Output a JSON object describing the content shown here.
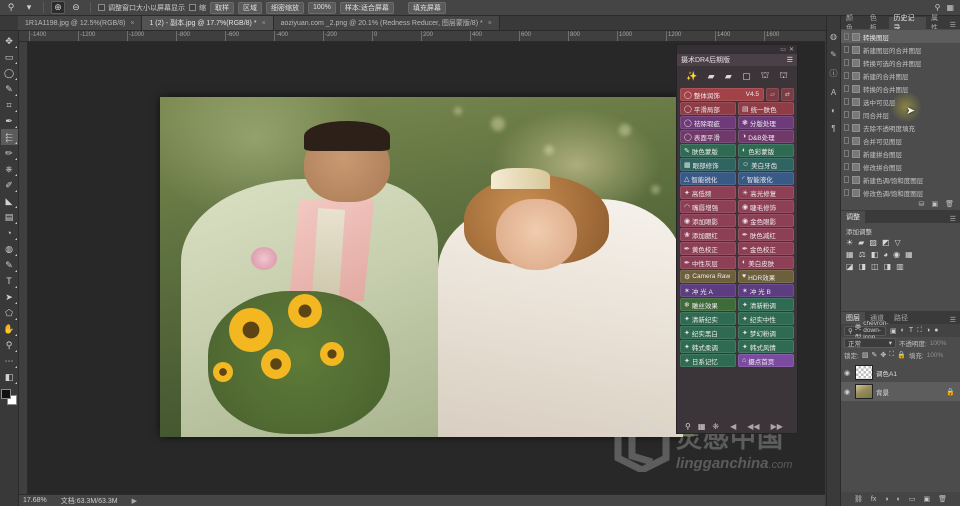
{
  "options_bar": {
    "tool_icon": "zoom-icon",
    "dropdown_icon": "chevron-down-icon",
    "zoom_in_icon": "zoom-in-icon",
    "zoom_out_icon": "zoom-out-icon",
    "checkbox1_label": "调整窗口大小以屏幕显示",
    "checkbox2_label": "缩",
    "buttons": [
      "取样",
      "区域",
      "细密缩放"
    ],
    "zoom_value": "100%",
    "fit_label": "样本:适合屏幕",
    "fill_label": "填充屏幕"
  },
  "tabs": [
    {
      "label": "1R1A1198.jpg @ 12.5%(RGB/8)",
      "close": "×",
      "active": false
    },
    {
      "label": "1 (2) - 副本.jpg @ 17.7%(RGB/8) *",
      "close": "×",
      "active": true
    },
    {
      "label": "aoziyuan.com _2.png @ 20.1% (Redness Reducer, 图层蒙版/8) *",
      "close": "×",
      "active": false
    }
  ],
  "toolbar": {
    "tools": [
      {
        "name": "move-tool",
        "glyph": "✥"
      },
      {
        "name": "marquee-tool",
        "glyph": "▭"
      },
      {
        "name": "lasso-tool",
        "glyph": "◯"
      },
      {
        "name": "quick-select-tool",
        "glyph": "✎"
      },
      {
        "name": "crop-tool",
        "glyph": "⌗"
      },
      {
        "name": "eyedropper-tool",
        "glyph": "✒"
      },
      {
        "name": "healing-brush-tool",
        "glyph": "⬱"
      },
      {
        "name": "brush-tool",
        "glyph": "✏"
      },
      {
        "name": "clone-stamp-tool",
        "glyph": "⎈"
      },
      {
        "name": "history-brush-tool",
        "glyph": "✐"
      },
      {
        "name": "eraser-tool",
        "glyph": "◣"
      },
      {
        "name": "gradient-tool",
        "glyph": "▤"
      },
      {
        "name": "blur-tool",
        "glyph": "◔"
      },
      {
        "name": "dodge-tool",
        "glyph": "◍"
      },
      {
        "name": "pen-tool",
        "glyph": "✎"
      },
      {
        "name": "type-tool",
        "glyph": "T"
      },
      {
        "name": "path-select-tool",
        "glyph": "➤"
      },
      {
        "name": "shape-tool",
        "glyph": "⬠"
      },
      {
        "name": "hand-tool",
        "glyph": "✋"
      },
      {
        "name": "zoom-tool",
        "glyph": "⚲"
      },
      {
        "name": "more-tools",
        "glyph": "⋯"
      },
      {
        "name": "quickmask-tool",
        "glyph": "◧"
      }
    ],
    "active_tool_index": 6,
    "foreground_color": "#111111",
    "background_color": "#ffffff"
  },
  "ruler": {
    "ticks": [
      "-1400",
      "-1200",
      "-1000",
      "-800",
      "-600",
      "-400",
      "-200",
      "0",
      "200",
      "400",
      "600",
      "800",
      "1000",
      "1200",
      "1400",
      "1600"
    ]
  },
  "dr_panel": {
    "title": "摄术DR4后期版",
    "menu_icon": "panel-menu-icon",
    "minimize_icon": "minimize-icon",
    "close_icon": "close-icon",
    "toolicons": [
      "magic-wand-icon",
      "eraser-icon",
      "eraser-alt-icon",
      "rectangle-icon",
      "stamp-icon",
      "stamp-plus-icon"
    ],
    "rows": [
      {
        "buttons": [
          {
            "label": "整体润饰",
            "version": "V4.5",
            "icon": "lasso-icon",
            "color": "#a04248",
            "wide": true
          },
          {
            "label": "",
            "icon": "shape-icon",
            "color": "#7c3a42",
            "mini": true
          },
          {
            "label": "",
            "icon": "sliders-icon",
            "color": "#7c3a42",
            "mini": true
          }
        ]
      },
      {
        "buttons": [
          {
            "label": "平滑局部",
            "icon": "lasso-icon",
            "color": "#8e3d47"
          },
          {
            "label": "统一肤色",
            "icon": "layers-icon",
            "color": "#8e3d47"
          }
        ]
      },
      {
        "buttons": [
          {
            "label": "祛除瑕疵",
            "icon": "lasso-icon",
            "color": "#6d3b7a"
          },
          {
            "label": "分版处理",
            "icon": "stack-icon",
            "color": "#6d3b7a"
          }
        ]
      },
      {
        "buttons": [
          {
            "label": "表面平滑",
            "icon": "lasso-icon",
            "color": "#6f3a6a"
          },
          {
            "label": "D&B处理",
            "icon": "circle-icon",
            "color": "#6f3a6a"
          }
        ]
      },
      {
        "buttons": [
          {
            "label": "肤色蒙版",
            "icon": "brush-icon",
            "color": "#2f6b52"
          },
          {
            "label": "色彩蒙版",
            "icon": "mask-icon",
            "color": "#2f6b52"
          }
        ]
      },
      {
        "buttons": [
          {
            "label": "眼部修饰",
            "icon": "film-icon",
            "color": "#2f6460"
          },
          {
            "label": "美白牙齿",
            "icon": "teeth-icon",
            "color": "#2f6460"
          }
        ]
      },
      {
        "buttons": [
          {
            "label": "智能锐化",
            "icon": "triangle-icon",
            "color": "#3a5a86"
          },
          {
            "label": "智能液化",
            "icon": "liquify-icon",
            "color": "#3a5a86"
          }
        ]
      },
      {
        "buttons": [
          {
            "label": "高低频",
            "icon": "wand-icon",
            "color": "#8c3f55"
          },
          {
            "label": "高光修复",
            "icon": "sun-icon",
            "color": "#8c3f55"
          }
        ]
      },
      {
        "buttons": [
          {
            "label": "嘴唇增强",
            "icon": "lips-icon",
            "color": "#8c3f55"
          },
          {
            "label": "睫毛修饰",
            "icon": "eye-icon",
            "color": "#8c3f55"
          }
        ]
      },
      {
        "buttons": [
          {
            "label": "添加眼影",
            "icon": "eye-icon",
            "color": "#8c3f55"
          },
          {
            "label": "金色眼影",
            "icon": "eye-icon",
            "color": "#8c3f55"
          }
        ]
      },
      {
        "buttons": [
          {
            "label": "添加腮红",
            "icon": "blush-icon",
            "color": "#8c3f55"
          },
          {
            "label": "肤色减红",
            "icon": "pen-icon",
            "color": "#8c3f55"
          }
        ]
      },
      {
        "buttons": [
          {
            "label": "黄色校正",
            "icon": "pen-icon",
            "color": "#8c3f55"
          },
          {
            "label": "金色校正",
            "icon": "pen-icon",
            "color": "#8c3f55"
          }
        ]
      },
      {
        "buttons": [
          {
            "label": "中性灰层",
            "icon": "pen-icon",
            "color": "#8c3f55"
          },
          {
            "label": "美白皮肤",
            "icon": "mask-icon",
            "color": "#8c3f55"
          }
        ]
      },
      {
        "buttons": [
          {
            "label": "Camera Raw",
            "icon": "gear-icon",
            "color": "#6b5f3c"
          },
          {
            "label": "HDR效果",
            "icon": "heart-icon",
            "color": "#6b5f3c"
          }
        ]
      },
      {
        "buttons": [
          {
            "label": "冲 光 A",
            "icon": "star-icon",
            "color": "#5b3d80"
          },
          {
            "label": "冲 光 B",
            "icon": "star-icon",
            "color": "#5b3d80"
          }
        ]
      },
      {
        "buttons": [
          {
            "label": "雕丝效果",
            "icon": "snowflake-icon",
            "color": "#3f6b3a"
          },
          {
            "label": "清新粉调",
            "icon": "wand-icon",
            "color": "#2f6b52"
          }
        ]
      },
      {
        "buttons": [
          {
            "label": "清新纪实",
            "icon": "wand-icon",
            "color": "#2f6b52"
          },
          {
            "label": "纪实中性",
            "icon": "wand-icon",
            "color": "#2f6b52"
          }
        ]
      },
      {
        "buttons": [
          {
            "label": "纪实黑白",
            "icon": "wand-icon",
            "color": "#2f6b52"
          },
          {
            "label": "梦幻粉调",
            "icon": "wand-icon",
            "color": "#2f6b52"
          }
        ]
      },
      {
        "buttons": [
          {
            "label": "韩式柔调",
            "icon": "wand-icon",
            "color": "#2f6b52"
          },
          {
            "label": "韩式风情",
            "icon": "wand-icon",
            "color": "#2f6b52"
          }
        ]
      },
      {
        "buttons": [
          {
            "label": "日系记忆",
            "icon": "wand-icon",
            "color": "#2f6b52"
          },
          {
            "label": "摄点首页",
            "icon": "home-icon",
            "color": "#7b4ba0"
          }
        ]
      }
    ],
    "footer_icons": [
      "search-icon",
      "grid-icon",
      "settings-icon"
    ],
    "footer_nav": [
      "◀",
      "◀◀",
      "▶▶"
    ]
  },
  "right_dock": {
    "icon_rail": [
      "color-wheel-icon",
      "brush-preset-icon",
      "info-icon",
      "char-style-icon",
      "adjust-icon",
      "paragraph-icon"
    ],
    "top_tabs": [
      {
        "label": "颜色",
        "active": false
      },
      {
        "label": "色板",
        "active": false
      },
      {
        "label": "历史记录",
        "active": true
      },
      {
        "label": "属性",
        "active": false
      }
    ],
    "history": {
      "menu_icon": "panel-menu-icon",
      "items": [
        {
          "label": "转换图层",
          "selected": true
        },
        {
          "label": "新建图层的合并图层"
        },
        {
          "label": "转换可选的合并图层"
        },
        {
          "label": "新建的合并图层"
        },
        {
          "label": "转换的合并图层"
        },
        {
          "label": "选中可见层"
        },
        {
          "label": "同合并层"
        },
        {
          "label": "去除不透明度填充"
        },
        {
          "label": "合并可见图层"
        },
        {
          "label": "新建拼合图层"
        },
        {
          "label": "修改拼合图层"
        },
        {
          "label": "新建色调/饱和度图层"
        },
        {
          "label": "修改色调/饱和度图层"
        }
      ],
      "tools": [
        "snapshot-icon",
        "camera-icon",
        "trash-icon"
      ]
    },
    "adjustments": {
      "tab_label": "调整",
      "menu_icon": "panel-menu-icon",
      "section_label": "添加调整",
      "rows": [
        [
          "brightness-icon",
          "levels-icon",
          "curves-icon",
          "exposure-icon",
          "vibrance-icon"
        ],
        [
          "hue-sat-icon",
          "color-balance-icon",
          "bw-icon",
          "photo-filter-icon",
          "channel-mixer-icon",
          "color-lookup-icon"
        ],
        [
          "invert-icon",
          "posterize-icon",
          "threshold-icon",
          "gradient-map-icon",
          "selective-color-icon"
        ]
      ]
    },
    "layers": {
      "tabs": [
        {
          "label": "图层",
          "active": true
        },
        {
          "label": "通道",
          "active": false
        },
        {
          "label": "路径",
          "active": false
        }
      ],
      "menu_icon": "panel-menu-icon",
      "filter_kind_label": "类型",
      "filter_search_icon": "search-icon",
      "filter_chevron": "chevron-down-icon",
      "filter_icons": [
        "image-filter-icon",
        "adjust-filter-icon",
        "type-filter-icon",
        "shape-filter-icon",
        "smart-filter-icon",
        "toggle-filter-icon"
      ],
      "blend_mode": "正常",
      "blend_chevron": "chevron-down-icon",
      "opacity_label": "不透明度:",
      "opacity_value": "100%",
      "lock_label": "锁定:",
      "lock_icons": [
        "lock-transparent-icon",
        "lock-image-icon",
        "lock-position-icon",
        "lock-artboard-icon",
        "lock-all-icon"
      ],
      "fill_label": "填充:",
      "fill_value": "100%",
      "items": [
        {
          "name": "调色A1",
          "visible": true,
          "thumb": "checker",
          "locked": false,
          "selected": false
        },
        {
          "name": "背景",
          "visible": true,
          "thumb": "photo",
          "locked": true,
          "selected": true
        }
      ],
      "bottom_icons": [
        "link-icon",
        "fx-icon",
        "mask-icon",
        "adjustment-icon",
        "group-icon",
        "new-layer-icon",
        "trash-icon"
      ]
    }
  },
  "status_bar": {
    "zoom": "17.68%",
    "doc_info": "文档:63.3M/63.3M",
    "arrow": "▶"
  },
  "watermark": {
    "cn": "灵感中国",
    "en": "lingganchina",
    "tld": ".com",
    "logo": "lingganchina-logo"
  },
  "cursor": {
    "icon": "pointer-cursor"
  }
}
